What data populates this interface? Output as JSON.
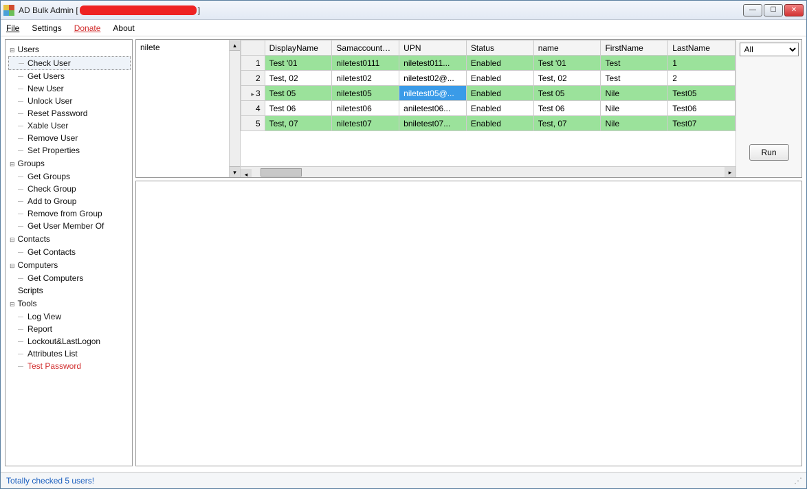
{
  "window": {
    "title_prefix": "AD Bulk Admin [",
    "title_suffix": "]"
  },
  "menu": {
    "file": "File",
    "settings": "Settings",
    "donate": "Donate",
    "about": "About"
  },
  "tree": {
    "users": {
      "label": "Users",
      "items": [
        "Check User",
        "Get Users",
        "New User",
        "Unlock User",
        "Reset Password",
        "Xable User",
        "Remove User",
        "Set Properties"
      ]
    },
    "groups": {
      "label": "Groups",
      "items": [
        "Get Groups",
        "Check Group",
        "Add to Group",
        "Remove from Group",
        "Get User Member Of"
      ]
    },
    "contacts": {
      "label": "Contacts",
      "items": [
        "Get Contacts"
      ]
    },
    "computers": {
      "label": "Computers",
      "items": [
        "Get Computers"
      ]
    },
    "scripts": {
      "label": "Scripts"
    },
    "tools": {
      "label": "Tools",
      "items": [
        "Log View",
        "Report",
        "Lockout&LastLogon",
        "Attributes List",
        "Test Password"
      ]
    }
  },
  "search": {
    "text": "nilete"
  },
  "grid": {
    "columns": [
      "DisplayName",
      "SamaccountNan",
      "UPN",
      "Status",
      "name",
      "FirstName",
      "LastName"
    ],
    "rows": [
      {
        "n": "1",
        "green": true,
        "cells": [
          "Test '01",
          "niletest0111",
          "niletest011...",
          "Enabled",
          "Test '01",
          "Test",
          "1"
        ]
      },
      {
        "n": "2",
        "green": false,
        "cells": [
          "Test, 02",
          "niletest02",
          "niletest02@...",
          "Enabled",
          "Test, 02",
          "Test",
          "2"
        ]
      },
      {
        "n": "3",
        "green": true,
        "current": true,
        "selcol": 2,
        "cells": [
          "Test 05",
          "niletest05",
          "niletest05@...",
          "Enabled",
          "Test 05",
          "Nile",
          "Test05"
        ]
      },
      {
        "n": "4",
        "green": false,
        "cells": [
          "Test 06",
          "niletest06",
          "aniletest06...",
          "Enabled",
          "Test 06",
          "Nile",
          "Test06"
        ]
      },
      {
        "n": "5",
        "green": true,
        "cells": [
          "Test, 07",
          "niletest07",
          "bniletest07...",
          "Enabled",
          "Test, 07",
          "Nile",
          "Test07"
        ]
      }
    ]
  },
  "sidepanel": {
    "filter_value": "All",
    "run_label": "Run"
  },
  "status": {
    "message": "Totally checked 5 users!"
  }
}
